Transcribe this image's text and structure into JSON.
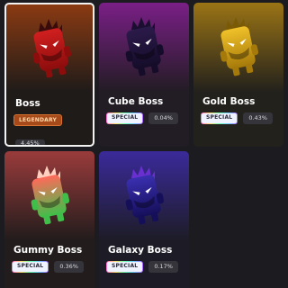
{
  "cards": [
    {
      "name": "Boss",
      "badge": "LEGENDARY",
      "badge_type": "legendary",
      "odds": "4.45%",
      "selected": true,
      "icon": "boss-creature-icon",
      "colors": {
        "bg_top": "#8a3a12",
        "bg_bottom": "#1f1b19",
        "body": "#d11f1f",
        "body_dark": "#8d0d0d",
        "crown": "#3a0b0b"
      }
    },
    {
      "name": "Cube Boss",
      "badge": "SPECIAL",
      "badge_type": "special",
      "odds": "0.04%",
      "selected": false,
      "icon": "cube-boss-creature-icon",
      "colors": {
        "bg_top": "#7a1f86",
        "bg_bottom": "#221c24",
        "body": "#2b1a4a",
        "body_dark": "#150c29",
        "crown": "#1a0f30"
      }
    },
    {
      "name": "Gold Boss",
      "badge": "SPECIAL",
      "badge_type": "special",
      "odds": "0.43%",
      "selected": false,
      "icon": "gold-boss-creature-icon",
      "colors": {
        "bg_top": "#9a7415",
        "bg_bottom": "#23211c",
        "body": "#f0c12a",
        "body_dark": "#a67a0a",
        "crown": "#7a5a05"
      }
    },
    {
      "name": "Gummy Boss",
      "badge": "SPECIAL",
      "badge_type": "special",
      "odds": "0.36%",
      "selected": false,
      "icon": "gummy-boss-creature-icon",
      "colors": {
        "bg_top": "#9a3b3b",
        "bg_bottom": "#221c1c",
        "body": "#ff6a5a",
        "body_dark": "#3fbf4a",
        "crown": "#ffd0c0"
      }
    },
    {
      "name": "Galaxy Boss",
      "badge": "SPECIAL",
      "badge_type": "special",
      "odds": "0.17%",
      "selected": false,
      "icon": "galaxy-boss-creature-icon",
      "colors": {
        "bg_top": "#3a2a9a",
        "bg_bottom": "#1d1c26",
        "body": "#3a2fb0",
        "body_dark": "#150f5a",
        "crown": "#6a2fd0"
      }
    }
  ]
}
